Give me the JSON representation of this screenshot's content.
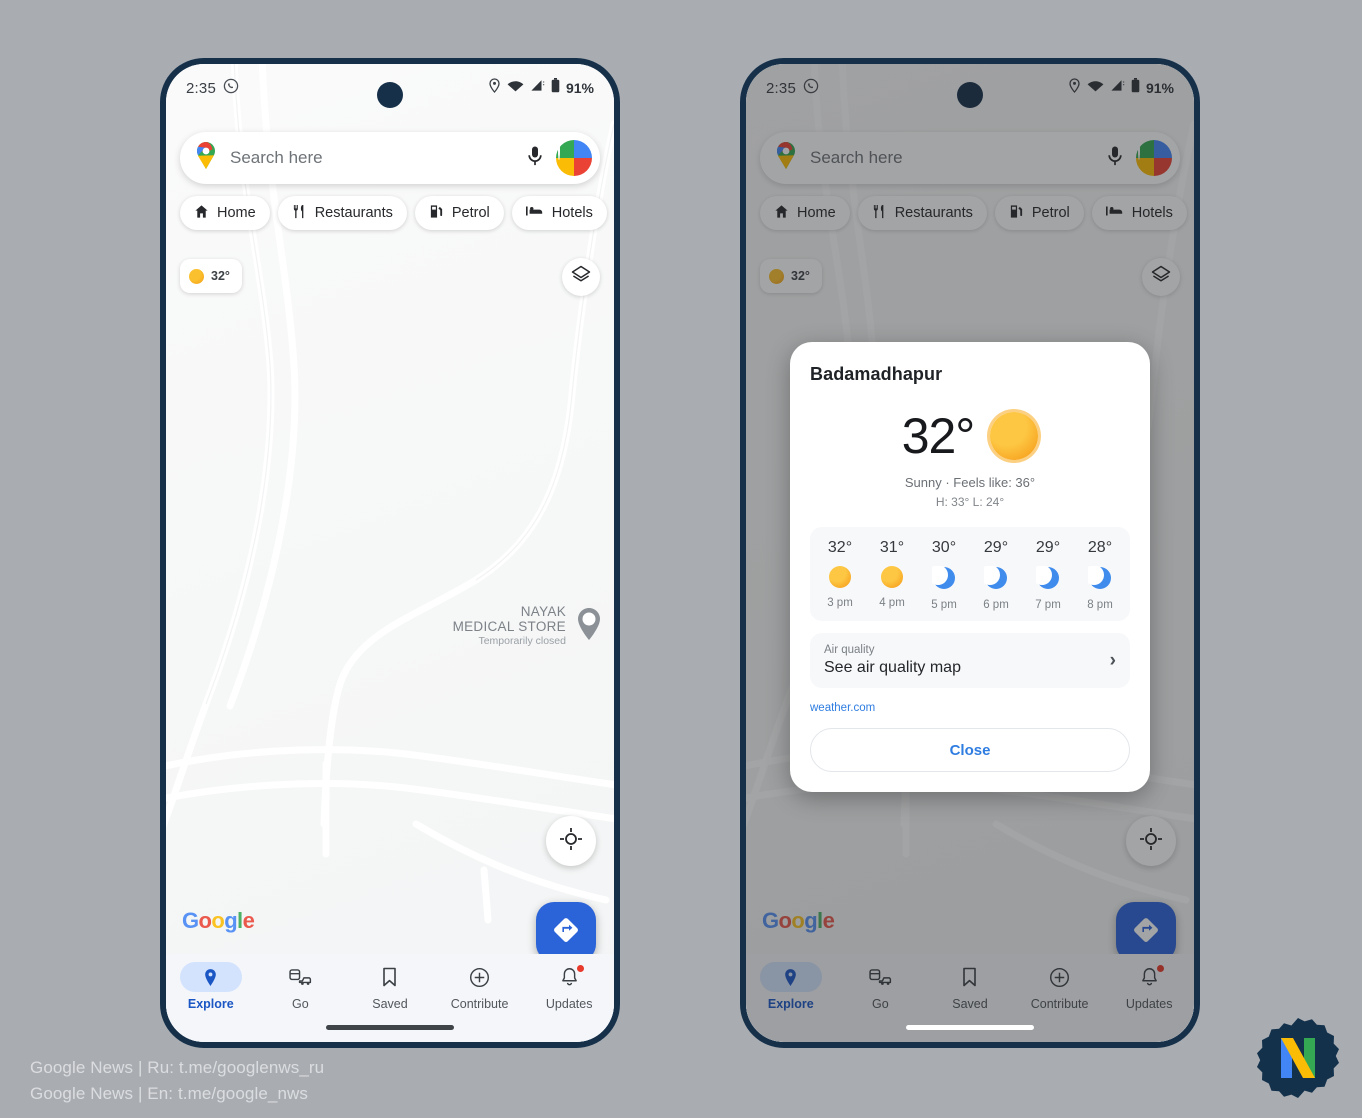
{
  "status_bar": {
    "time": "2:35",
    "battery_percent": "91%",
    "icons": [
      "whatsapp-icon",
      "location-pin-icon",
      "wifi-icon",
      "signal-icon",
      "battery-icon"
    ]
  },
  "search": {
    "placeholder": "Search here",
    "maps_pin_icon": "google-maps-pin-icon",
    "mic_icon": "microphone-icon",
    "avatar_icon": "profile-avatar"
  },
  "chips": [
    {
      "label": "Home",
      "icon": "home-icon"
    },
    {
      "label": "Restaurants",
      "icon": "restaurant-icon"
    },
    {
      "label": "Petrol",
      "icon": "fuel-pump-icon"
    },
    {
      "label": "Hotels",
      "icon": "hotel-bed-icon"
    }
  ],
  "weather_chip": {
    "temp": "32°",
    "icon": "sun-icon"
  },
  "layers_button": {
    "icon": "layers-icon"
  },
  "map": {
    "poi_line1": "NAYAK",
    "poi_line2": "MEDICAL STORE",
    "poi_status": "Temporarily closed",
    "poi_icon": "medical-store-pin-icon",
    "google_wordmark": [
      "G",
      "o",
      "o",
      "g",
      "l",
      "e"
    ]
  },
  "fabs": {
    "my_location_icon": "my-location-icon",
    "directions_icon": "directions-arrow-icon"
  },
  "bottom_nav": {
    "items": [
      {
        "label": "Explore",
        "icon": "map-pin-icon",
        "active": true,
        "badge": false
      },
      {
        "label": "Go",
        "icon": "commute-icon",
        "active": false,
        "badge": false
      },
      {
        "label": "Saved",
        "icon": "bookmark-icon",
        "active": false,
        "badge": false
      },
      {
        "label": "Contribute",
        "icon": "plus-circle-icon",
        "active": false,
        "badge": false
      },
      {
        "label": "Updates",
        "icon": "bell-icon",
        "active": false,
        "badge": true
      }
    ]
  },
  "weather_dialog": {
    "title": "Badamadhapur",
    "temperature": "32°",
    "condition_icon": "sun-icon",
    "condition": "Sunny · Feels like: 36°",
    "high_low": "H: 33° L: 24°",
    "hourly": [
      {
        "temp": "32°",
        "icon": "sun-icon",
        "time": "3 pm"
      },
      {
        "temp": "31°",
        "icon": "sun-icon",
        "time": "4 pm"
      },
      {
        "temp": "30°",
        "icon": "moon-icon",
        "time": "5 pm"
      },
      {
        "temp": "29°",
        "icon": "moon-icon",
        "time": "6 pm"
      },
      {
        "temp": "29°",
        "icon": "moon-icon",
        "time": "7 pm"
      },
      {
        "temp": "28°",
        "icon": "moon-icon",
        "time": "8 pm"
      }
    ],
    "air_quality_label": "Air quality",
    "air_quality_action": "See air quality map",
    "chevron_icon": "chevron-right-icon",
    "attribution": "weather.com",
    "close_label": "Close"
  },
  "watermark": {
    "line1": "Google News | Ru: t.me/googlenws_ru",
    "line2": "Google News | En: t.me/google_nws",
    "logo_icon": "news-n-badge-logo"
  },
  "colors": {
    "page_bg": "#a9adb2",
    "phone_frame": "#16304a",
    "accent_blue": "#2b63d9",
    "link_blue": "#2f7de1",
    "active_pill": "#d3e3fd",
    "badge_red": "#e8392b",
    "sun_orange": "#f59512",
    "moon_blue": "#3f8ced"
  }
}
